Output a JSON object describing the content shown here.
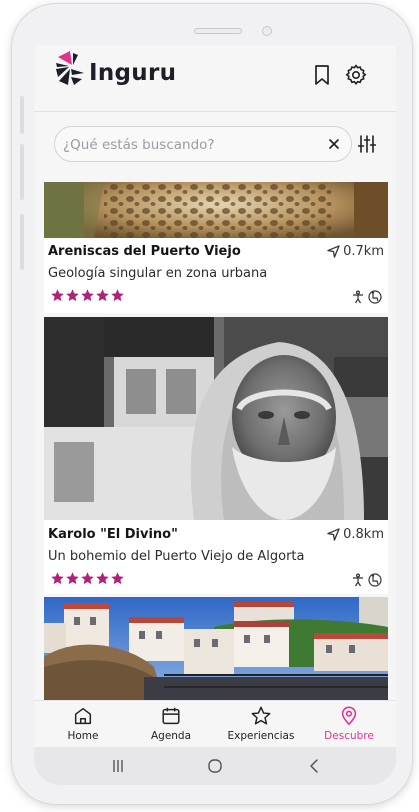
{
  "app": {
    "name": "Inguru"
  },
  "search": {
    "placeholder": "¿Qué estás buscando?",
    "value": ""
  },
  "colors": {
    "accent": "#e0358f",
    "star": "#b0217a"
  },
  "cards": [
    {
      "title": "Areniscas del Puerto Viejo",
      "subtitle": "Geología singular en zona urbana",
      "distance": "0.7km",
      "rating": 5,
      "badges": [
        "accessibility-icon",
        "wheelchair-icon"
      ]
    },
    {
      "title": "Karolo \"El Divino\"",
      "subtitle": "Un bohemio del Puerto Viejo de Algorta",
      "distance": "0.8km",
      "rating": 5,
      "badges": [
        "accessibility-icon",
        "wheelchair-icon"
      ]
    },
    {
      "title": "",
      "subtitle": "",
      "distance": "",
      "rating": 0,
      "badges": []
    }
  ],
  "tabs": [
    {
      "label": "Home",
      "icon": "home-icon",
      "active": false
    },
    {
      "label": "Agenda",
      "icon": "calendar-icon",
      "active": false
    },
    {
      "label": "Experiencias",
      "icon": "star-outline-icon",
      "active": false
    },
    {
      "label": "Descubre",
      "icon": "location-pin-icon",
      "active": true
    }
  ],
  "system_nav": [
    "recent-apps-icon",
    "home-circle-icon",
    "back-icon"
  ]
}
